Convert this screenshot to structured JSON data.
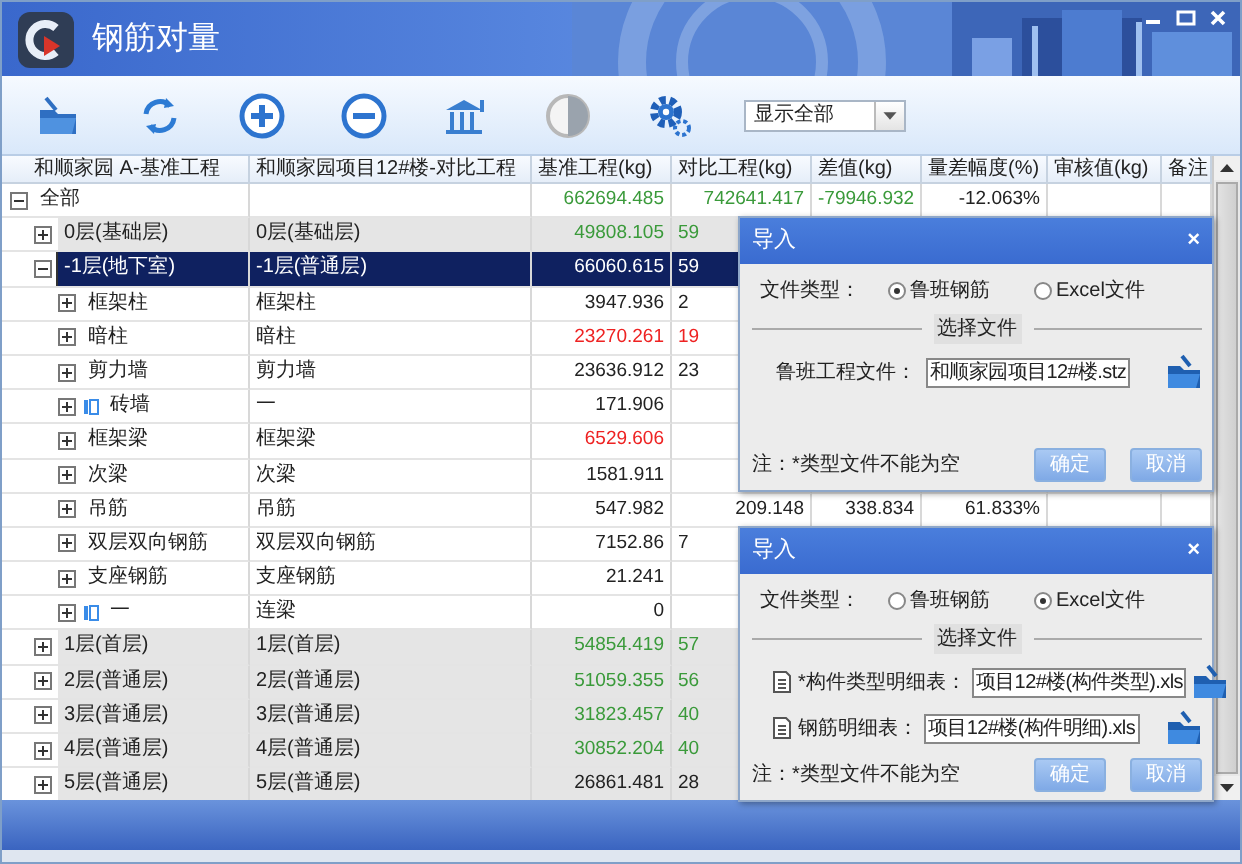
{
  "window": {
    "title": "钢筋对量"
  },
  "toolbar": {
    "dropdown": "显示全部"
  },
  "table": {
    "columns": [
      "和顺家园 A-基准工程",
      "和顺家园项目12#楼-对比工程",
      "基准工程(kg)",
      "对比工程(kg)",
      "差值(kg)",
      "量差幅度(%)",
      "审核值(kg)",
      "备注"
    ],
    "rows": [
      {
        "name": "全部",
        "base": "662694.485",
        "compare": "742641.417",
        "diff": "-79946.932",
        "range": "-12.063%",
        "color": "#3a9a3a",
        "expanded": true,
        "selected": false,
        "shaded": false,
        "children": [
          {
            "name": "0层(基础层)",
            "compare_name": "0层(基础层)",
            "base": "49808.105",
            "compare": "59",
            "color": "#3a9a3a",
            "expanded": false,
            "selected": false,
            "shaded": true,
            "covered": true
          },
          {
            "name": "-1层(地下室)",
            "compare_name": "-1层(普通层)",
            "base": "66060.615",
            "compare": "59",
            "expanded": true,
            "selected": true,
            "shaded": false,
            "covered": true,
            "children": [
              {
                "name": "框架柱",
                "compare_name": "框架柱",
                "base": "3947.936",
                "compare": "2",
                "expanded": false,
                "selected": false,
                "shaded": false,
                "covered": true
              },
              {
                "name": "暗柱",
                "compare_name": "暗柱",
                "base": "23270.261",
                "compare": "19",
                "color": "#ee2222",
                "expanded": false,
                "selected": false,
                "shaded": false,
                "covered": true
              },
              {
                "name": "剪力墙",
                "compare_name": "剪力墙",
                "base": "23636.912",
                "compare": "23",
                "expanded": false,
                "selected": false,
                "shaded": false,
                "covered": true
              },
              {
                "name": "砖墙",
                "compare_name": "一",
                "base": "171.906",
                "marked": true,
                "expanded": false,
                "selected": false,
                "shaded": false
              },
              {
                "name": "框架梁",
                "compare_name": "框架梁",
                "base": "6529.606",
                "color": "#ee2222",
                "expanded": false,
                "selected": false,
                "shaded": false
              },
              {
                "name": "次梁",
                "compare_name": "次梁",
                "base": "1581.911",
                "expanded": false,
                "selected": false,
                "shaded": false
              },
              {
                "name": "吊筋",
                "compare_name": "吊筋",
                "base": "547.982",
                "compare": "209.148",
                "diff": "338.834",
                "range": "61.833%",
                "expanded": false,
                "selected": false,
                "shaded": false
              },
              {
                "name": "双层双向钢筋",
                "compare_name": "双层双向钢筋",
                "base": "7152.86",
                "compare": "7",
                "expanded": false,
                "selected": false,
                "shaded": false,
                "covered": true
              },
              {
                "name": "支座钢筋",
                "compare_name": "支座钢筋",
                "base": "21.241",
                "expanded": false,
                "selected": false,
                "shaded": false
              },
              {
                "name": "一",
                "compare_name": "连梁",
                "base": "0",
                "marked": true,
                "expanded": false,
                "selected": false,
                "shaded": false
              }
            ]
          },
          {
            "name": "1层(首层)",
            "compare_name": "1层(首层)",
            "base": "54854.419",
            "compare": "57",
            "color": "#3a9a3a",
            "expanded": false,
            "selected": false,
            "shaded": true,
            "covered": true
          },
          {
            "name": "2层(普通层)",
            "compare_name": "2层(普通层)",
            "base": "51059.355",
            "compare": "56",
            "color": "#3a9a3a",
            "expanded": false,
            "selected": false,
            "shaded": true,
            "covered": true
          },
          {
            "name": "3层(普通层)",
            "compare_name": "3层(普通层)",
            "base": "31823.457",
            "compare": "40",
            "color": "#3a9a3a",
            "expanded": false,
            "selected": false,
            "shaded": true,
            "covered": true
          },
          {
            "name": "4层(普通层)",
            "compare_name": "4层(普通层)",
            "base": "30852.204",
            "compare": "40",
            "color": "#3a9a3a",
            "expanded": false,
            "selected": false,
            "shaded": true,
            "covered": true
          },
          {
            "name": "5层(普通层)",
            "compare_name": "5层(普通层)",
            "base": "26861.481",
            "compare": "28",
            "expanded": false,
            "selected": false,
            "shaded": true,
            "covered": true
          }
        ]
      }
    ]
  },
  "dialogs": [
    {
      "title": "导入",
      "close": "×",
      "file_type_label": "文件类型：",
      "options": [
        {
          "label": "鲁班钢筋",
          "selected": true
        },
        {
          "label": "Excel文件",
          "selected": false
        }
      ],
      "section": "选择文件",
      "fields": [
        {
          "kind": "plain",
          "label": "鲁班工程文件：",
          "value": "和顺家园项目12#楼.stz"
        }
      ],
      "note": "注：*类型文件不能为空",
      "buttons": [
        "确定",
        "取消"
      ]
    },
    {
      "title": "导入",
      "close": "×",
      "file_type_label": "文件类型：",
      "options": [
        {
          "label": "鲁班钢筋",
          "selected": false
        },
        {
          "label": "Excel文件",
          "selected": true
        }
      ],
      "section": "选择文件",
      "fields": [
        {
          "kind": "sheet",
          "label": "*构件类型明细表：",
          "value": "项目12#楼(构件类型).xls"
        },
        {
          "kind": "sheet",
          "label": "钢筋明细表：",
          "value": "项目12#楼(构件明细).xls"
        }
      ],
      "note": "注：*类型文件不能为空",
      "buttons": [
        "确定",
        "取消"
      ]
    }
  ]
}
